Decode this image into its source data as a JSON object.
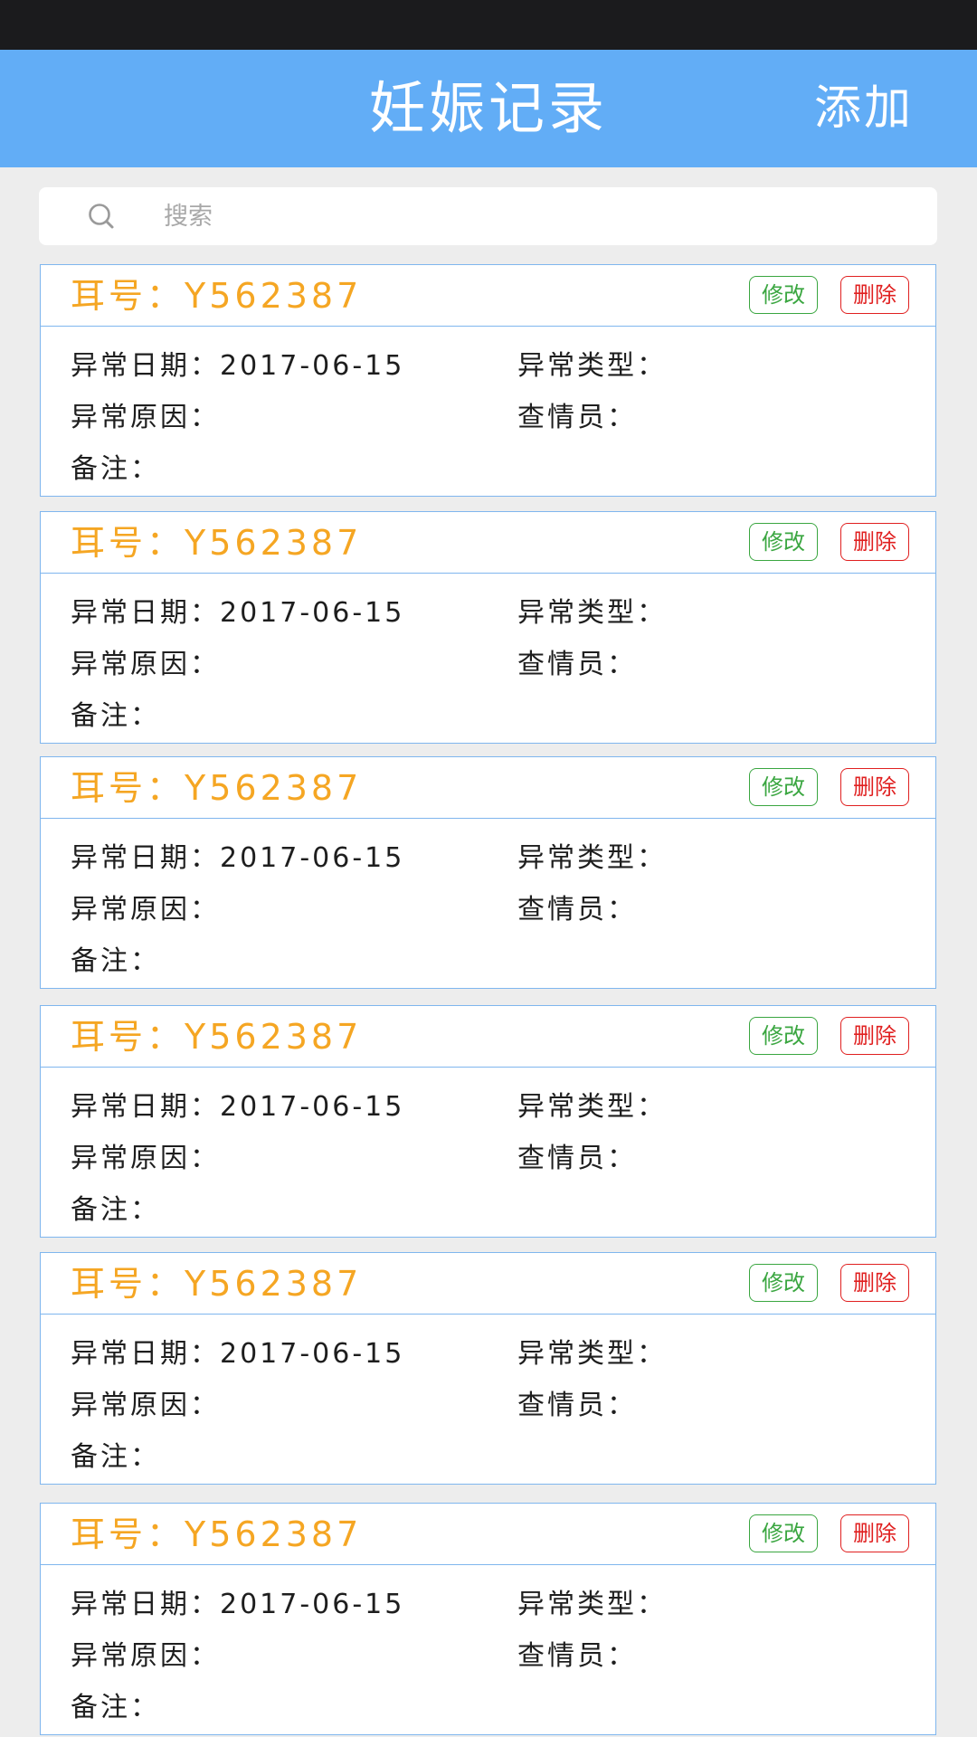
{
  "header": {
    "title": "妊娠记录",
    "add_label": "添加"
  },
  "search": {
    "placeholder": "搜索",
    "value": ""
  },
  "colors": {
    "header_bg": "#62adf6",
    "ear_label": "#f5a623",
    "edit": "#3aa640",
    "delete": "#e02020",
    "card_border": "#7fb6ee"
  },
  "records": [
    {
      "ear": "耳号：Y562387",
      "edit_label": "修改",
      "delete_label": "删除",
      "date": "异常日期：2017-06-15",
      "type": "异常类型：",
      "reason": "异常原因：",
      "inspector": "查情员：",
      "note": "备注："
    },
    {
      "ear": "耳号：Y562387",
      "edit_label": "修改",
      "delete_label": "删除",
      "date": "异常日期：2017-06-15",
      "type": "异常类型：",
      "reason": "异常原因：",
      "inspector": "查情员：",
      "note": "备注："
    },
    {
      "ear": "耳号：Y562387",
      "edit_label": "修改",
      "delete_label": "删除",
      "date": "异常日期：2017-06-15",
      "type": "异常类型：",
      "reason": "异常原因：",
      "inspector": "查情员：",
      "note": "备注："
    },
    {
      "ear": "耳号：Y562387",
      "edit_label": "修改",
      "delete_label": "删除",
      "date": "异常日期：2017-06-15",
      "type": "异常类型：",
      "reason": "异常原因：",
      "inspector": "查情员：",
      "note": "备注："
    },
    {
      "ear": "耳号：Y562387",
      "edit_label": "修改",
      "delete_label": "删除",
      "date": "异常日期：2017-06-15",
      "type": "异常类型：",
      "reason": "异常原因：",
      "inspector": "查情员：",
      "note": "备注："
    },
    {
      "ear": "耳号：Y562387",
      "edit_label": "修改",
      "delete_label": "删除",
      "date": "异常日期：2017-06-15",
      "type": "异常类型：",
      "reason": "异常原因：",
      "inspector": "查情员：",
      "note": "备注："
    }
  ]
}
